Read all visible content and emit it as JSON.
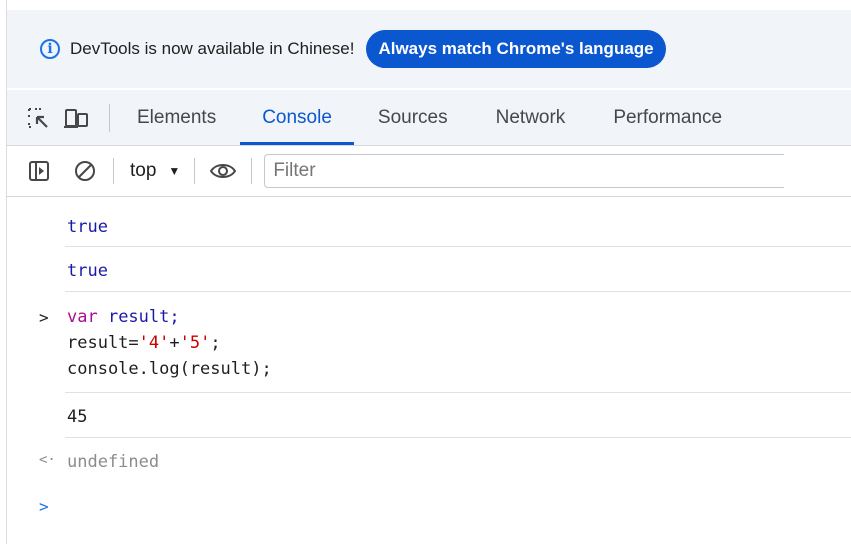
{
  "infobar": {
    "icon": "info-icon",
    "message": "DevTools is now available in Chinese!",
    "button_label": "Always match Chrome's language"
  },
  "tabs": {
    "items": [
      {
        "label": "Elements",
        "active": false
      },
      {
        "label": "Console",
        "active": true
      },
      {
        "label": "Sources",
        "active": false
      },
      {
        "label": "Network",
        "active": false
      },
      {
        "label": "Performance",
        "active": false
      }
    ],
    "icons": [
      "inspect-element-icon",
      "device-toolbar-icon"
    ]
  },
  "console_toolbar": {
    "icons": [
      "sidebar-toggle-icon",
      "clear-console-icon",
      "live-expression-eye-icon"
    ],
    "context_label": "top",
    "filter_placeholder": "Filter"
  },
  "console": {
    "entries": [
      {
        "type": "output",
        "text": "true"
      },
      {
        "type": "output",
        "text": "true"
      },
      {
        "type": "input",
        "lines": [
          [
            {
              "t": "var",
              "c": "kw"
            },
            {
              "t": " result;",
              "c": "blue"
            }
          ],
          [
            {
              "t": "result=",
              "c": "plain"
            },
            {
              "t": "'4'",
              "c": "str"
            },
            {
              "t": "+",
              "c": "plain"
            },
            {
              "t": "'5'",
              "c": "str"
            },
            {
              "t": ";",
              "c": "plain"
            }
          ],
          [
            {
              "t": "console.log(result);",
              "c": "plain"
            }
          ]
        ]
      },
      {
        "type": "log",
        "text": "45"
      },
      {
        "type": "return",
        "text": "undefined"
      }
    ],
    "input_prompt_symbol": ">",
    "return_symbol": "<·"
  },
  "colors": {
    "accent": "#0b57d0",
    "value_blue": "#1a1aa6",
    "keyword": "#a90d91",
    "string": "#c80000",
    "muted": "#8c8c8c"
  }
}
